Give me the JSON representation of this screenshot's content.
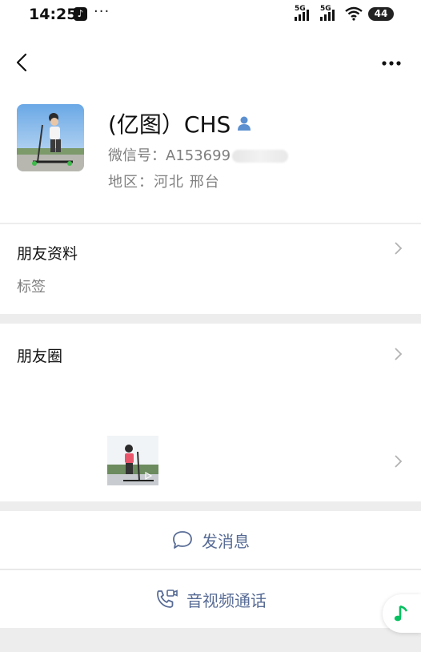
{
  "status_bar": {
    "time": "14:25",
    "dots": "···",
    "net1": "5G",
    "net2": "5G",
    "battery": "44"
  },
  "profile": {
    "name": "(亿图）CHS",
    "wechat_id": "微信号：A153699",
    "region": "地区：河北  邢台"
  },
  "friend_info": {
    "title": "朋友资料",
    "subtitle": "标签"
  },
  "moments": {
    "title": "朋友圈"
  },
  "actions": {
    "message": "发消息",
    "call": "音视频通话"
  },
  "colors": {
    "link": "#576b95",
    "background": "#ededed",
    "music_green": "#07c160"
  }
}
